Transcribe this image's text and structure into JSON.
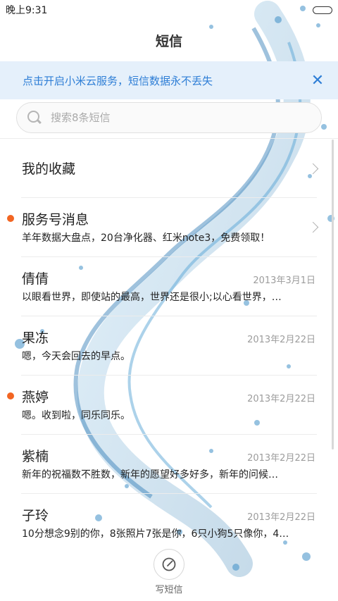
{
  "status_bar": {
    "time": "晚上9:31"
  },
  "header": {
    "title": "短信"
  },
  "banner": {
    "text": "点击开启小米云服务，短信数据永不丢失",
    "close_icon": "close-icon",
    "color": "#2e7ed6",
    "background": "#e5f0fb"
  },
  "search": {
    "placeholder": "搜索8条短信",
    "value": ""
  },
  "conversations": [
    {
      "name": "我的收藏",
      "preview": "",
      "date": "",
      "unread": false,
      "chevron": true
    },
    {
      "name": "服务号消息",
      "preview": "羊年数据大盘点，20台净化器、红米note3，免费领取！",
      "date": "",
      "unread": true,
      "chevron": true
    },
    {
      "name": "倩倩",
      "preview": "以眼看世界，即使站的最高，世界还是很小;以心看世界，…",
      "date": "2013年3月1日",
      "unread": false,
      "chevron": false
    },
    {
      "name": "果冻",
      "preview": "嗯，今天会回去的早点。",
      "date": "2013年2月22日",
      "unread": false,
      "chevron": false
    },
    {
      "name": "燕婷",
      "preview": "嗯。收到啦，同乐同乐。",
      "date": "2013年2月22日",
      "unread": true,
      "chevron": false
    },
    {
      "name": "紫楠",
      "preview": "新年的祝福数不胜数，新年的愿望好多好多，新年的问候…",
      "date": "2013年2月22日",
      "unread": false,
      "chevron": false
    },
    {
      "name": "子玲",
      "preview": "10分想念9别的你，8张照片7张是你，6只小狗5只像你，4…",
      "date": "2013年2月22日",
      "unread": false,
      "chevron": false
    }
  ],
  "compose": {
    "label": "写短信",
    "icon": "compose-icon"
  },
  "colors": {
    "unread_dot": "#f26522",
    "date": "#9c9c9c"
  }
}
